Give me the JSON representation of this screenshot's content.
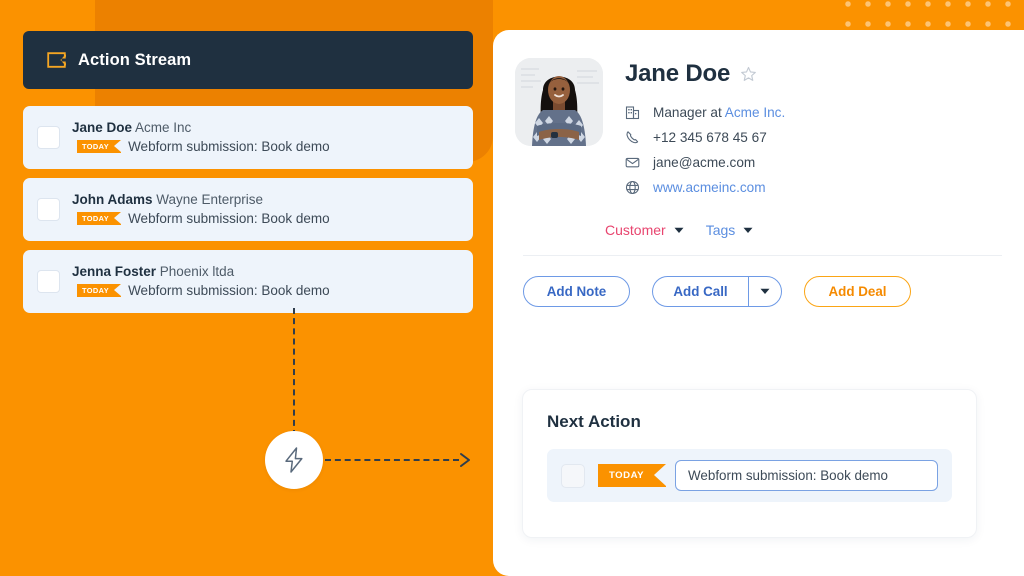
{
  "theme": {
    "orange": "#fb9200",
    "orange_dark": "#ec8100",
    "navy": "#1f3040",
    "card_blue": "#eef4fb",
    "link_blue": "#5b8ee0",
    "pink": "#e8456f"
  },
  "stream": {
    "icon": "action-stream-icon",
    "title": "Action Stream",
    "items": [
      {
        "name": "Jane Doe",
        "company": "Acme Inc",
        "badge": "TODAY",
        "text": "Webform submission: Book demo"
      },
      {
        "name": "John Adams",
        "company": "Wayne Enterprise",
        "badge": "TODAY",
        "text": "Webform submission: Book demo"
      },
      {
        "name": "Jenna Foster",
        "company": "Phoenix ltda",
        "badge": "TODAY",
        "text": "Webform submission: Book demo"
      }
    ]
  },
  "flow": {
    "node_icon": "lightning-bolt-icon",
    "arrow_icon": "arrow-right-icon"
  },
  "contact": {
    "avatar_alt": "avatar",
    "name": "Jane Doe",
    "favorite_icon": "star-icon",
    "rows": [
      {
        "icon": "building-icon",
        "prefix": "Manager at ",
        "link": "Acme Inc."
      },
      {
        "icon": "phone-icon",
        "prefix": "+12 345 678 45 67",
        "link": ""
      },
      {
        "icon": "envelope-icon",
        "prefix": "jane@acme.com",
        "link": ""
      },
      {
        "icon": "globe-icon",
        "prefix": "",
        "link": "www.acmeinc.com"
      }
    ],
    "meta": {
      "customer_label": "Customer",
      "tags_label": "Tags"
    }
  },
  "actions": {
    "add_note": "Add Note",
    "add_call": "Add Call",
    "add_call_caret": "caret-down-icon",
    "add_deal": "Add Deal"
  },
  "next_action": {
    "title": "Next Action",
    "badge": "TODAY",
    "input_value": "Webform submission: Book demo",
    "input_placeholder": "Webform submission: Book demo"
  }
}
